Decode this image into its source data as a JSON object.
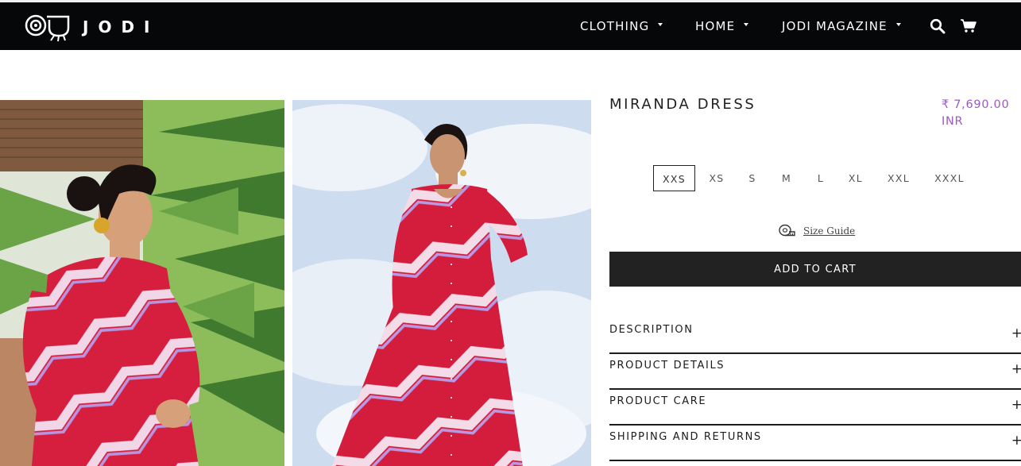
{
  "brand": {
    "name": "JODI"
  },
  "nav": {
    "items": [
      {
        "label": "CLOTHING"
      },
      {
        "label": "HOME"
      },
      {
        "label": "JODI MAGAZINE"
      }
    ]
  },
  "product": {
    "title": "MIRANDA DRESS",
    "price": "₹ 7,690.00",
    "currency": "INR",
    "sizes": [
      "XXS",
      "XS",
      "S",
      "M",
      "L",
      "XL",
      "XXL",
      "XXXL"
    ],
    "selected_size": "XXS",
    "size_guide_label": "Size Guide",
    "add_to_cart_label": "ADD TO CART",
    "accordions": [
      {
        "label": "DESCRIPTION"
      },
      {
        "label": "PRODUCT DETAILS"
      },
      {
        "label": "PRODUCT CARE"
      },
      {
        "label": "SHIPPING AND RETURNS"
      }
    ],
    "accordion_icon": "+"
  },
  "colors": {
    "header_bg": "#060708",
    "price": "#9b59c2",
    "button_bg": "#222222"
  },
  "icons": {
    "logo": "jodi-logo-icon",
    "search": "search-icon",
    "cart": "cart-icon",
    "size_guide": "measuring-tape-icon",
    "nav_caret": "caret-down-icon"
  }
}
